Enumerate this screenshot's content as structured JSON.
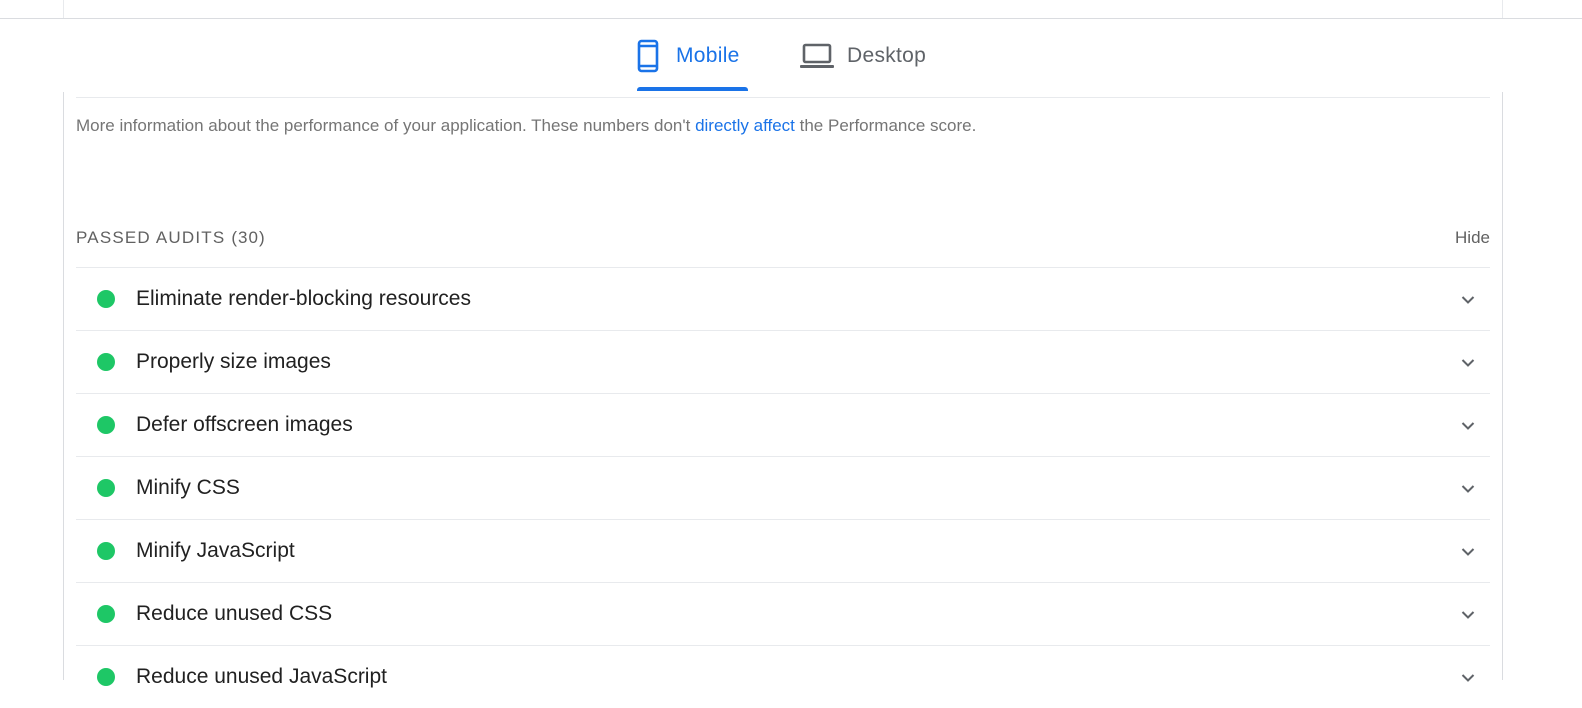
{
  "tabs": [
    {
      "label": "Mobile",
      "icon": "smartphone-icon",
      "selected": true
    },
    {
      "label": "Desktop",
      "icon": "laptop-icon",
      "selected": false
    }
  ],
  "description": {
    "before": "More information about the performance of your application. These numbers don't ",
    "link": "directly affect",
    "after": " the Performance score."
  },
  "passed_audits": {
    "title": "PASSED AUDITS",
    "count": "(30)",
    "hide_label": "Hide",
    "items": [
      {
        "title": "Eliminate render-blocking resources",
        "status": "pass"
      },
      {
        "title": "Properly size images",
        "status": "pass"
      },
      {
        "title": "Defer offscreen images",
        "status": "pass"
      },
      {
        "title": "Minify CSS",
        "status": "pass"
      },
      {
        "title": "Minify JavaScript",
        "status": "pass"
      },
      {
        "title": "Reduce unused CSS",
        "status": "pass"
      },
      {
        "title": "Reduce unused JavaScript",
        "status": "pass"
      }
    ]
  },
  "colors": {
    "accent": "#1a73e8",
    "pass": "#1ec766"
  }
}
